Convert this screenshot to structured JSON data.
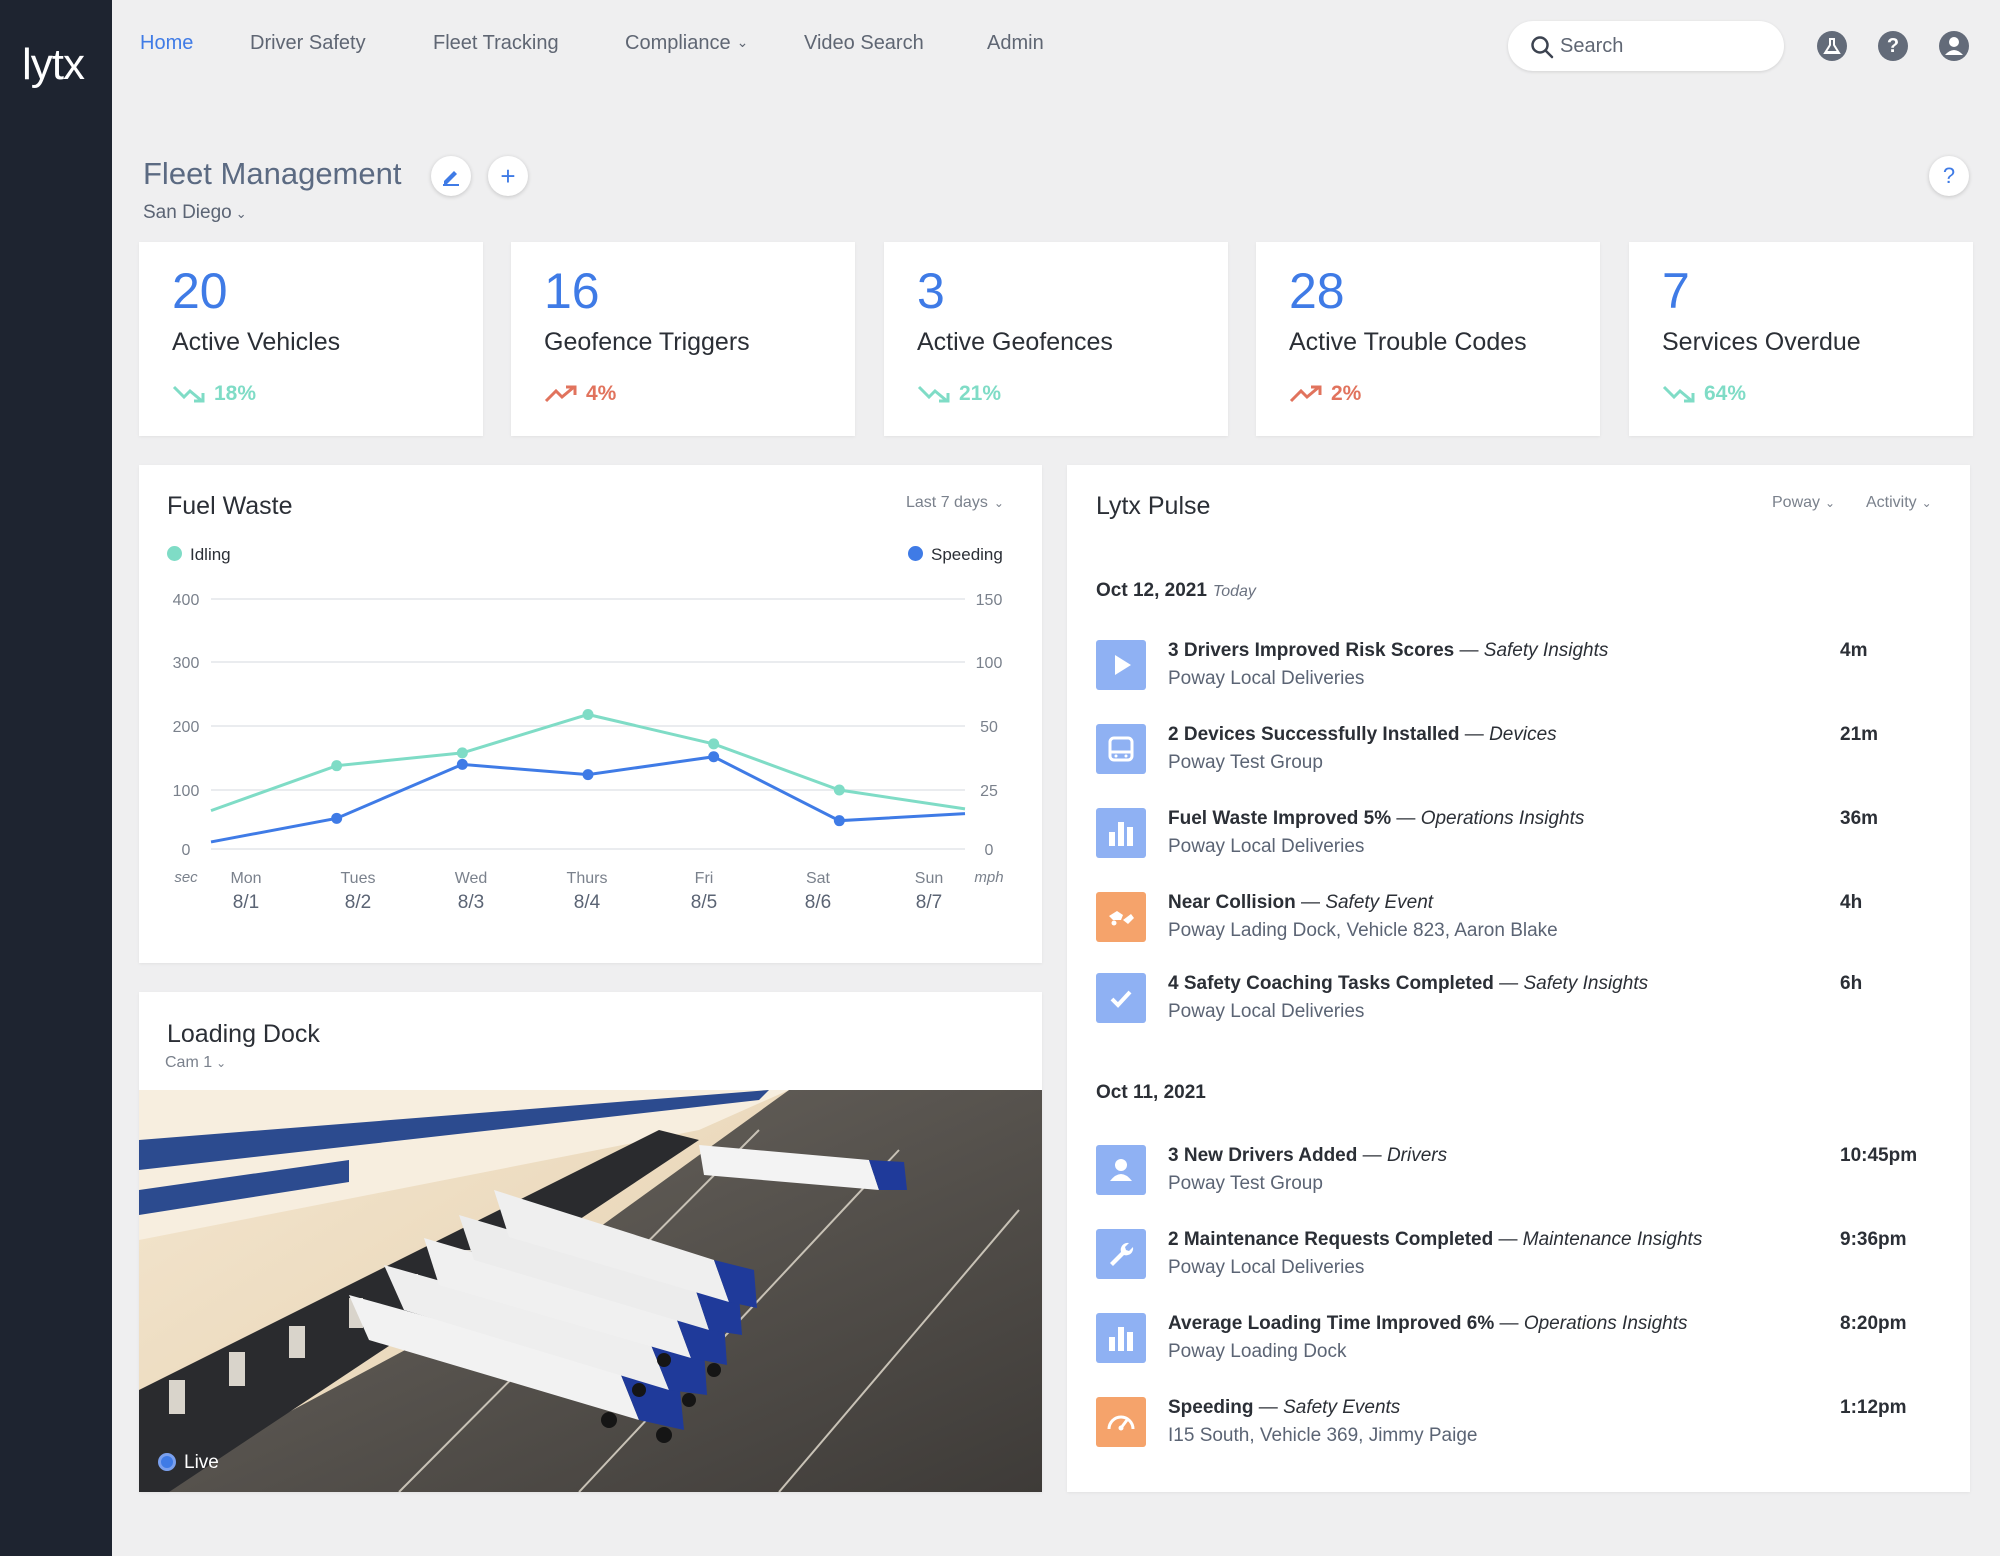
{
  "app": {
    "logo": "lytx"
  },
  "nav": {
    "items": [
      {
        "label": "Home",
        "active": true
      },
      {
        "label": "Driver Safety"
      },
      {
        "label": "Fleet Tracking"
      },
      {
        "label": "Compliance",
        "dropdown": true
      },
      {
        "label": "Video Search"
      },
      {
        "label": "Admin"
      }
    ],
    "search_placeholder": "Search",
    "icons": [
      "flask-icon",
      "help-icon",
      "user-icon"
    ]
  },
  "page": {
    "title": "Fleet Management",
    "location": "San Diego",
    "help": "?"
  },
  "stats": [
    {
      "value": "20",
      "label": "Active Vehicles",
      "trend": "18%",
      "direction": "down",
      "color": "#7fdcc6"
    },
    {
      "value": "16",
      "label": "Geofence Triggers",
      "trend": "4%",
      "direction": "up",
      "color": "#e1735d"
    },
    {
      "value": "3",
      "label": "Active Geofences",
      "trend": "21%",
      "direction": "down",
      "color": "#7fdcc6"
    },
    {
      "value": "28",
      "label": "Active Trouble Codes",
      "trend": "2%",
      "direction": "up",
      "color": "#e1735d"
    },
    {
      "value": "7",
      "label": "Services Overdue",
      "trend": "64%",
      "direction": "down",
      "color": "#7fdcc6"
    }
  ],
  "fuel_waste": {
    "title": "Fuel Waste",
    "filter": "Last 7 days",
    "legend_left": "Idling",
    "legend_right": "Speeding",
    "left_unit": "sec",
    "right_unit": "mph"
  },
  "chart_data": {
    "type": "line",
    "title": "Fuel Waste",
    "x": [
      "Mon 8/1",
      "Tues 8/2",
      "Wed 8/3",
      "Thurs 8/4",
      "Fri 8/5",
      "Sat 8/6",
      "Sun 8/7"
    ],
    "x_day": [
      "Mon",
      "Tues",
      "Wed",
      "Thurs",
      "Fri",
      "Sat",
      "Sun"
    ],
    "x_date": [
      "8/1",
      "8/2",
      "8/3",
      "8/4",
      "8/5",
      "8/6",
      "8/7"
    ],
    "left_axis": {
      "unit": "sec",
      "ticks": [
        0,
        100,
        200,
        300,
        400
      ]
    },
    "right_axis": {
      "unit": "mph",
      "ticks": [
        0,
        25,
        50,
        100,
        150
      ]
    },
    "series": [
      {
        "name": "Idling",
        "axis": "left",
        "color": "#7fdcc6",
        "x": [
          0,
          1,
          2,
          3,
          4,
          5,
          6
        ],
        "values": [
          65,
          138,
          158,
          218,
          172,
          100,
          68
        ]
      },
      {
        "name": "Speeding",
        "axis": "right",
        "color": "#3f7be6",
        "x": [
          0,
          1,
          2,
          3,
          4,
          5,
          6
        ],
        "values": [
          3,
          13,
          35,
          31,
          38,
          12,
          15
        ]
      }
    ],
    "grid": true,
    "legend": "top"
  },
  "loading_dock": {
    "title": "Loading Dock",
    "camera": "Cam 1",
    "status": "Live"
  },
  "pulse": {
    "title": "Lytx Pulse",
    "filter_location": "Poway",
    "filter_type": "Activity",
    "groups": [
      {
        "date": "Oct 12, 2021",
        "tag": "Today",
        "items": [
          {
            "title": "3 Drivers Improved Risk Scores",
            "category": "Safety Insights",
            "sub": "Poway Local Deliveries",
            "time": "4m",
            "icon": "play-icon",
            "color": "#8fb1f3"
          },
          {
            "title": "2 Devices Successfully Installed",
            "category": "Devices",
            "sub": "Poway Test Group",
            "time": "21m",
            "icon": "device-icon",
            "color": "#8fb1f3"
          },
          {
            "title": "Fuel Waste Improved 5%",
            "category": "Operations Insights",
            "sub": "Poway Local Deliveries",
            "time": "36m",
            "icon": "bar-chart-icon",
            "color": "#8fb1f3"
          },
          {
            "title": "Near Collision",
            "category": "Safety Event",
            "sub": "Poway Lading Dock, Vehicle 823, Aaron Blake",
            "time": "4h",
            "icon": "collision-icon",
            "color": "#f5a36b"
          },
          {
            "title": "4 Safety Coaching Tasks Completed",
            "category": "Safety Insights",
            "sub": "Poway Local Deliveries",
            "time": "6h",
            "icon": "check-icon",
            "color": "#8fb1f3"
          }
        ]
      },
      {
        "date": "Oct 11, 2021",
        "tag": "",
        "items": [
          {
            "title": "3 New Drivers Added",
            "category": "Drivers",
            "sub": "Poway Test Group",
            "time": "10:45pm",
            "icon": "person-icon",
            "color": "#8fb1f3"
          },
          {
            "title": "2 Maintenance Requests Completed",
            "category": "Maintenance Insights",
            "sub": "Poway Local Deliveries",
            "time": "9:36pm",
            "icon": "wrench-icon",
            "color": "#8fb1f3"
          },
          {
            "title": "Average Loading Time Improved 6%",
            "category": "Operations Insights",
            "sub": "Poway Loading Dock",
            "time": "8:20pm",
            "icon": "bar-chart-icon",
            "color": "#8fb1f3"
          },
          {
            "title": "Speeding",
            "category": "Safety Events",
            "sub": "I15 South, Vehicle 369, Jimmy Paige",
            "time": "1:12pm",
            "icon": "speedometer-icon",
            "color": "#f5a36b"
          }
        ]
      }
    ]
  }
}
